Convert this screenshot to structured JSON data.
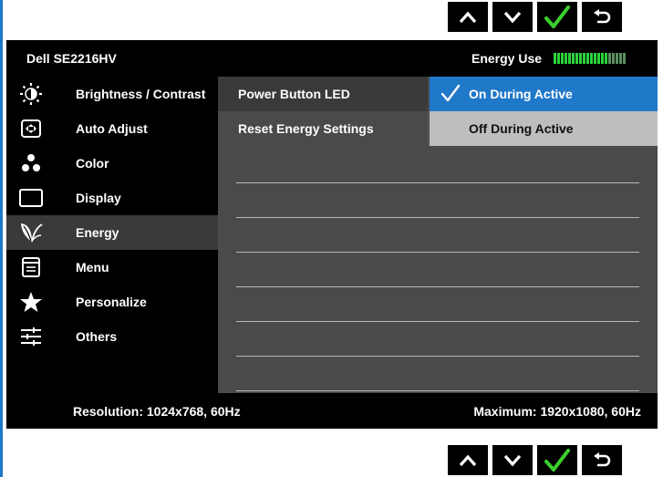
{
  "monitor": {
    "model": "Dell SE2216HV",
    "energy_use_label": "Energy Use",
    "energy_meter": {
      "lit_bars": 15,
      "total_bars": 20,
      "lit_color": "#2bd33a",
      "unlit_color": "#5b8f5e"
    }
  },
  "nav_buttons": [
    {
      "id": "up",
      "icon": "chevron-up-icon"
    },
    {
      "id": "down",
      "icon": "chevron-down-icon"
    },
    {
      "id": "ok",
      "icon": "checkmark-icon",
      "color": "#3bcf2d"
    },
    {
      "id": "back",
      "icon": "return-arrow-icon"
    }
  ],
  "menu": {
    "items": [
      {
        "label": "Brightness / Contrast",
        "icon": "brightness-icon"
      },
      {
        "label": "Auto Adjust",
        "icon": "auto-adjust-icon"
      },
      {
        "label": "Color",
        "icon": "color-icon"
      },
      {
        "label": "Display",
        "icon": "display-icon"
      },
      {
        "label": "Energy",
        "icon": "energy-leaf-icon",
        "active": true
      },
      {
        "label": "Menu",
        "icon": "menu-icon"
      },
      {
        "label": "Personalize",
        "icon": "star-icon"
      },
      {
        "label": "Others",
        "icon": "sliders-icon"
      }
    ]
  },
  "energy_submenu": {
    "items": [
      {
        "label": "Power Button LED",
        "active": true
      },
      {
        "label": "Reset Energy Settings"
      }
    ],
    "options": [
      {
        "label": "On During Active",
        "selected": true
      },
      {
        "label": "Off During Active",
        "selected": false
      }
    ]
  },
  "footer": {
    "resolution": "Resolution: 1024x768, 60Hz",
    "maximum": "Maximum: 1920x1080, 60Hz"
  },
  "colors": {
    "accent": "#1f78c8",
    "osd_bg": "#000000",
    "panel_bg": "#4a4a4a",
    "active_row": "#3a3a3a"
  }
}
